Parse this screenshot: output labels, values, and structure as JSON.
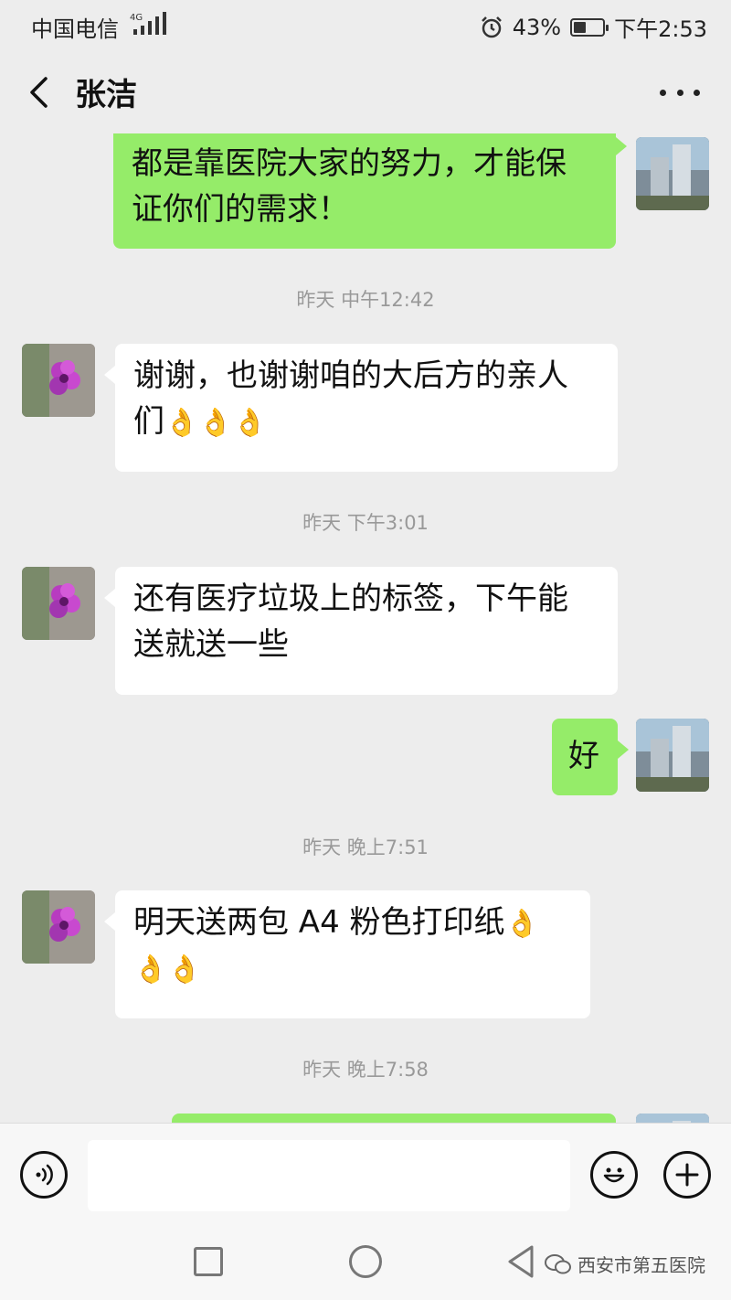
{
  "status_bar": {
    "carrier": "中国电信",
    "network": "4G",
    "battery": "43%",
    "time": "下午2:53",
    "battery_level": 0.43,
    "icons": [
      "signal-icon",
      "alarm-icon",
      "battery-icon"
    ]
  },
  "header": {
    "title": "张洁",
    "back_icon": "chevron-left-icon",
    "more_icon": "more-dots-icon"
  },
  "messages": [
    {
      "type": "out",
      "text_lines": [
        "都是靠医院大家的努力，才能保",
        "证你们的需求！"
      ]
    },
    {
      "type": "timestamp",
      "text": "昨天 中午12:42"
    },
    {
      "type": "in",
      "text_lines": [
        "谢谢，也谢谢咱的大后方的亲人",
        "们"
      ],
      "emoji": "👌👌👌"
    },
    {
      "type": "timestamp",
      "text": "昨天 下午3:01"
    },
    {
      "type": "in",
      "text_lines": [
        "还有医疗垃圾上的标签，下午能",
        "送就送一些"
      ]
    },
    {
      "type": "out",
      "text_lines": [
        "好"
      ]
    },
    {
      "type": "timestamp",
      "text": "昨天 晚上7:51"
    },
    {
      "type": "in",
      "text_lines": [
        "明天送两包 A4 粉色打印纸"
      ],
      "emoji_inline": "👌",
      "emoji_line2": "👌👌"
    },
    {
      "type": "timestamp",
      "text": "昨天 晚上7:58"
    }
  ],
  "input_bar": {
    "placeholder": "",
    "voice_icon": "voice-icon",
    "emoji_icon": "emoji-icon",
    "plus_icon": "plus-icon"
  },
  "nav_bar": {
    "watermark": "西安市第五医院",
    "icons": [
      "recent-apps-icon",
      "home-icon",
      "back-icon"
    ]
  },
  "colors": {
    "background": "#ededed",
    "outgoing_bubble": "#95ec69",
    "incoming_bubble": "#ffffff",
    "timestamp_text": "#999999"
  }
}
